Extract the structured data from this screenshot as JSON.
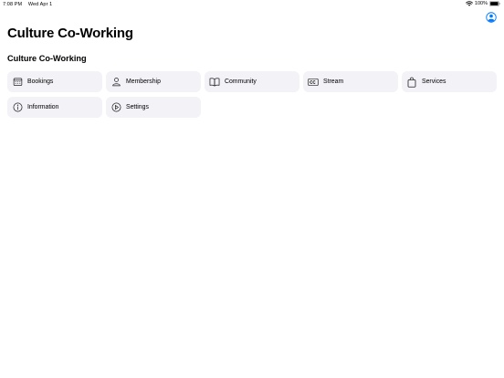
{
  "status_bar": {
    "time": "7:08 PM",
    "date": "Wed Apr 1",
    "battery_percent": "100%",
    "battery_level": 1.0
  },
  "header": {
    "title": "Culture Co-Working",
    "profile_icon": "person-circle-icon"
  },
  "section": {
    "title": "Culture Co-Working",
    "items": [
      {
        "label": "Bookings",
        "icon": "calendar-icon"
      },
      {
        "label": "Membership",
        "icon": "person-icon"
      },
      {
        "label": "Community",
        "icon": "book-icon"
      },
      {
        "label": "Stream",
        "icon": "captions-icon"
      },
      {
        "label": "Services",
        "icon": "bag-icon"
      },
      {
        "label": "Information",
        "icon": "info-icon"
      },
      {
        "label": "Settings",
        "icon": "settings-icon"
      }
    ]
  },
  "colors": {
    "accent": "#007aff",
    "tile_background": "#f2f2f7",
    "text": "#000000"
  }
}
